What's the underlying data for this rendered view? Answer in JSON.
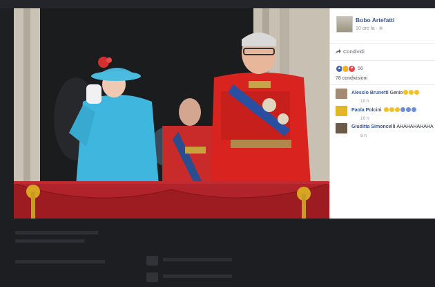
{
  "post": {
    "page_name": "Bobo Artefatti",
    "timestamp": "10 ore fa · ⊕",
    "share_label": "Condividi",
    "reaction_count": "56",
    "shares_label": "78 condivisioni"
  },
  "comments": [
    {
      "name": "Alessio Brunetti",
      "text": "Genio",
      "time": "10 h"
    },
    {
      "name": "Paola Polcini",
      "text": "",
      "time": "10 h"
    },
    {
      "name": "Giuditta Simoncelli",
      "text": "AHAHAHAHAHA",
      "time": "8 h"
    }
  ],
  "colors": {
    "link_blue": "#365899",
    "meta_gray": "#90949c",
    "like_blue": "#4267b2",
    "haha_yellow": "#f7b125",
    "love_red": "#f33e58"
  },
  "icons": [
    "share-icon",
    "like-reaction-icon",
    "haha-reaction-icon",
    "love-reaction-icon",
    "laughing-emoji-icon",
    "thumbs-up-emoji-icon"
  ]
}
